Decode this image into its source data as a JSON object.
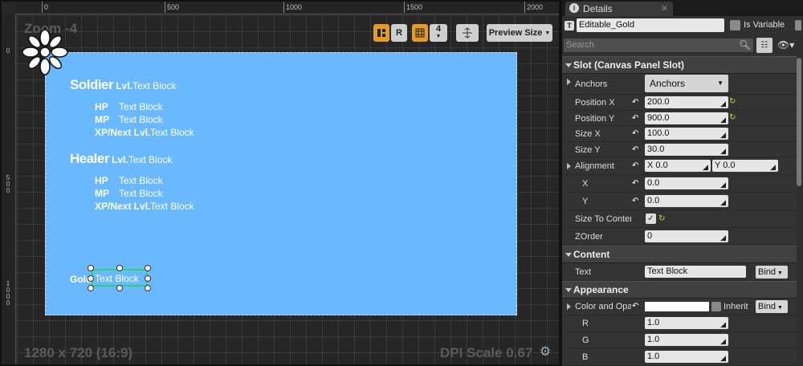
{
  "designer": {
    "zoom_label": "Zoom -4",
    "ruler_top": [
      "0",
      "500",
      "1000",
      "1500",
      "2000"
    ],
    "ruler_left": [
      "0",
      "500",
      "1000"
    ],
    "resolution_label": "1280 x 720 (16:9)",
    "dpi_label": "DPI Scale 0.67",
    "toolbar": {
      "r_label": "R",
      "grid_count": "4",
      "preview_label": "Preview Size"
    },
    "canvas": {
      "soldier_name": "Soldier",
      "soldier_lvl_prefix": "Lvl.",
      "soldier_lvl_value": "Text Block",
      "soldier_stats": [
        {
          "label": "HP",
          "value": "Text Block"
        },
        {
          "label": "MP",
          "value": "Text Block"
        },
        {
          "label": "XP/Next Lvl.",
          "value": "Text Block"
        }
      ],
      "healer_name": "Healer",
      "healer_lvl_prefix": "Lvl.",
      "healer_lvl_value": "Text Block",
      "healer_stats": [
        {
          "label": "HP",
          "value": "Text Block"
        },
        {
          "label": "MP",
          "value": "Text Block"
        },
        {
          "label": "XP/Next Lvl.",
          "value": "Text Block"
        }
      ],
      "gold_label": "Gold",
      "gold_value": "Text Block"
    }
  },
  "details": {
    "tab_title": "Details",
    "widget_name": "Editable_Gold",
    "is_variable_label": "Is Variable",
    "search_placeholder": "Search",
    "sections": {
      "slot": "Slot (Canvas Panel Slot)",
      "content": "Content",
      "appearance": "Appearance"
    },
    "anchors_label": "Anchors",
    "anchors_value": "Anchors",
    "position_x_label": "Position X",
    "position_x": "200.0",
    "position_y_label": "Position Y",
    "position_y": "900.0",
    "size_x_label": "Size X",
    "size_x": "100.0",
    "size_y_label": "Size Y",
    "size_y": "30.0",
    "alignment_label": "Alignment",
    "alignment_x": "X  0.0",
    "alignment_y": "Y  0.0",
    "align_x_label": "X",
    "align_x": "0.0",
    "align_y_label": "Y",
    "align_y": "0.0",
    "size_to_content_label": "Size To Content",
    "zorder_label": "ZOrder",
    "zorder": "0",
    "text_label": "Text",
    "text_value": "Text Block",
    "bind_label": "Bind",
    "color_label": "Color and Opacity",
    "inherit_label": "Inherit",
    "r_label": "R",
    "r_value": "1.0",
    "g_label": "G",
    "g_value": "1.0",
    "b_label": "B",
    "b_value": "1.0"
  },
  "colors": {
    "canvas_bg": "#6ab8ff",
    "selection": "#2fd36b",
    "toolbar_accent": "#e79a2c"
  }
}
